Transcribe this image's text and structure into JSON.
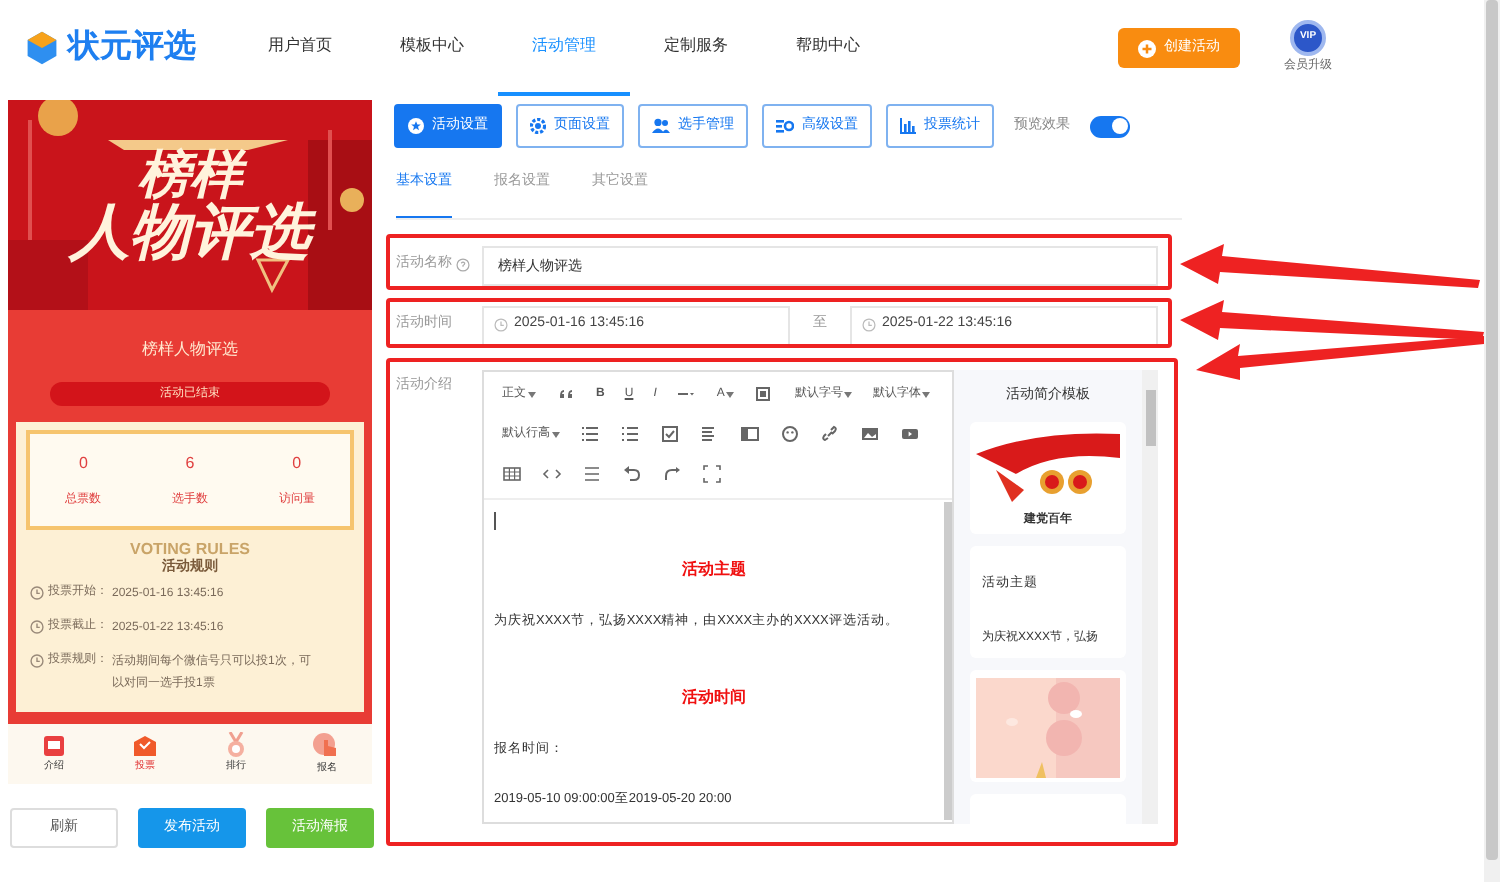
{
  "header": {
    "logo": "状元评选",
    "nav": [
      {
        "label": "用户首页",
        "selected": false
      },
      {
        "label": "模板中心",
        "selected": false
      },
      {
        "label": "活动管理",
        "selected": true
      },
      {
        "label": "定制服务",
        "selected": false
      },
      {
        "label": "帮助中心",
        "selected": false
      }
    ],
    "create_button": "创建活动",
    "vip_badge": "VIP",
    "vip_label": "会员升级"
  },
  "preview": {
    "banner_lines": [
      "榜样",
      "人物评选"
    ],
    "title": "榜样人物评选",
    "status": "活动已结束",
    "stats": [
      {
        "value": "0",
        "label": "总票数"
      },
      {
        "value": "6",
        "label": "选手数"
      },
      {
        "value": "0",
        "label": "访问量"
      }
    ],
    "rules_watermark": "VOTING RULES",
    "rules_title": "活动规则",
    "rules": [
      {
        "label": "投票开始：",
        "value": "2025-01-16 13:45:16"
      },
      {
        "label": "投票截止：",
        "value": "2025-01-22 13:45:16"
      },
      {
        "label": "投票规则：",
        "value": "活动期间每个微信号只可以投1次，可以对同一选手投1票"
      }
    ],
    "tabs": [
      {
        "label": "介绍",
        "selected": false
      },
      {
        "label": "投票",
        "selected": true
      },
      {
        "label": "排行",
        "selected": false
      },
      {
        "label": "报名",
        "selected": false
      }
    ]
  },
  "preview_buttons": [
    {
      "label": "刷新",
      "kind": "outline"
    },
    {
      "label": "发布活动",
      "kind": "blue"
    },
    {
      "label": "活动海报",
      "kind": "green"
    }
  ],
  "section_buttons": [
    {
      "label": "活动设置",
      "selected": true
    },
    {
      "label": "页面设置",
      "selected": false
    },
    {
      "label": "选手管理",
      "selected": false
    },
    {
      "label": "高级设置",
      "selected": false
    },
    {
      "label": "投票统计",
      "selected": false
    }
  ],
  "preview_toggle": {
    "label": "预览效果",
    "on": true
  },
  "sub_tabs": [
    {
      "label": "基本设置",
      "selected": true
    },
    {
      "label": "报名设置",
      "selected": false
    },
    {
      "label": "其它设置",
      "selected": false
    }
  ],
  "form": {
    "name": {
      "label": "活动名称",
      "value": "榜样人物评选"
    },
    "time": {
      "label": "活动时间",
      "start": "2025-01-16 13:45:16",
      "separator": "至",
      "end": "2025-01-22 13:45:16"
    },
    "intro": {
      "label": "活动介绍"
    }
  },
  "editor": {
    "toolbar_texts": [
      "正文",
      "B",
      "U",
      "I",
      "A",
      "默认字号",
      "默认字体",
      "默认行高"
    ],
    "content": [
      {
        "kind": "heading",
        "text": "活动主题"
      },
      {
        "kind": "paragraph",
        "text": "为庆祝XXXX节，弘扬XXXX精神，由XXXX主办的XXXX评选活动。"
      },
      {
        "kind": "heading",
        "text": "活动时间"
      },
      {
        "kind": "paragraph",
        "text": "报名时间："
      },
      {
        "kind": "paragraph",
        "text": "2019-05-10 09:00:00至2019-05-20 20:00"
      }
    ]
  },
  "templates": {
    "title": "活动简介模板",
    "cards": [
      {
        "kind": "picture",
        "caption": "建党百年"
      },
      {
        "kind": "text",
        "title": "活动主题",
        "snippet": "为庆祝XXXX节，弘扬"
      },
      {
        "kind": "picture"
      },
      {
        "kind": "blank"
      }
    ]
  }
}
